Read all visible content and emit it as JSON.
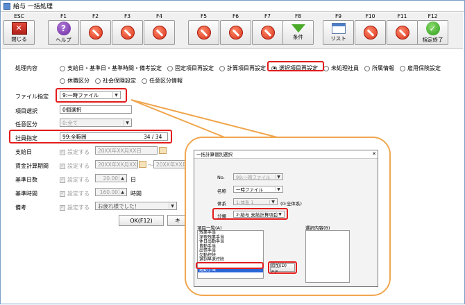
{
  "window": {
    "title": "給与 一括処理"
  },
  "fkeys": [
    {
      "key": "ESC",
      "caption": "閉じる",
      "icon": "exit-icon"
    },
    {
      "key": "F1",
      "caption": "ヘルプ",
      "icon": "help-icon"
    },
    {
      "key": "F2",
      "caption": "",
      "icon": "disabled-icon"
    },
    {
      "key": "F3",
      "caption": "",
      "icon": "disabled-icon"
    },
    {
      "key": "F4",
      "caption": "",
      "icon": "disabled-icon"
    },
    {
      "key": "F5",
      "caption": "",
      "icon": "disabled-icon"
    },
    {
      "key": "F6",
      "caption": "",
      "icon": "disabled-icon"
    },
    {
      "key": "F7",
      "caption": "",
      "icon": "disabled-icon"
    },
    {
      "key": "F8",
      "caption": "条件",
      "icon": "filter-icon"
    },
    {
      "key": "F9",
      "caption": "リスト",
      "icon": "list-icon"
    },
    {
      "key": "F10",
      "caption": "",
      "icon": "disabled-icon"
    },
    {
      "key": "F11",
      "caption": "",
      "icon": "disabled-icon"
    },
    {
      "key": "F12",
      "caption": "指定終了",
      "icon": "ok-icon"
    }
  ],
  "form": {
    "processing_label": "処理内容",
    "options_row1": [
      "支給日・基準日・基準時間・備考設定",
      "固定項目再設定",
      "計算項目再設定",
      "選択項目再設定",
      "未処理社員",
      "所属情報",
      "雇用保険設定"
    ],
    "options_row2": [
      "休職区分",
      "社会保険設定",
      "任意区分情報"
    ],
    "selected_option": "選択項目再設定",
    "file_label": "ファイル指定",
    "file_value": "9:一時ファイル",
    "item_label": "項目選択",
    "item_value": "0個選択",
    "optional_label": "任意区分",
    "optional_value": "0:全て",
    "employee_label": "社員指定",
    "employee_value": "99:全範囲",
    "employee_count": "34 / 34",
    "payday_label": "支給日",
    "wage_period_label": "賃金計算期間",
    "base_days_label": "基準日数",
    "base_time_label": "基準時間",
    "note_label": "備考",
    "set_label": "設定する",
    "date_placeholder": "20XX年XX月XX日",
    "period_sep": "～",
    "days_value": "20.00",
    "days_unit": "日",
    "hours_value": "160.00",
    "hours_unit": "時間",
    "note_value": "お疲れ様でした！",
    "ok_button": "OK(F12)",
    "cancel_partial": "キ"
  },
  "dialog": {
    "title": "一括計算個別選択",
    "no_label": "No.",
    "no_value": "99:一時ファイル",
    "name_label": "名称",
    "name_value": "一時ファイル",
    "system_label": "体系",
    "system_value": "1:体系 1",
    "system_note": "(0:全体系)",
    "category_label": "分類",
    "category_value": "2:給与 支給計算項目",
    "item_list_label": "項目一覧(A)",
    "items": [
      "残業手当",
      "深夜残業手当",
      "休日出勤手当",
      "皆勤手当",
      "出張手当",
      "欠勤控除",
      "遅刻早退控除",
      "通勤手当"
    ],
    "selected_item": "通勤手当",
    "add_button": "追加(D) >>",
    "selected_list_label": "選択内容(B)"
  }
}
